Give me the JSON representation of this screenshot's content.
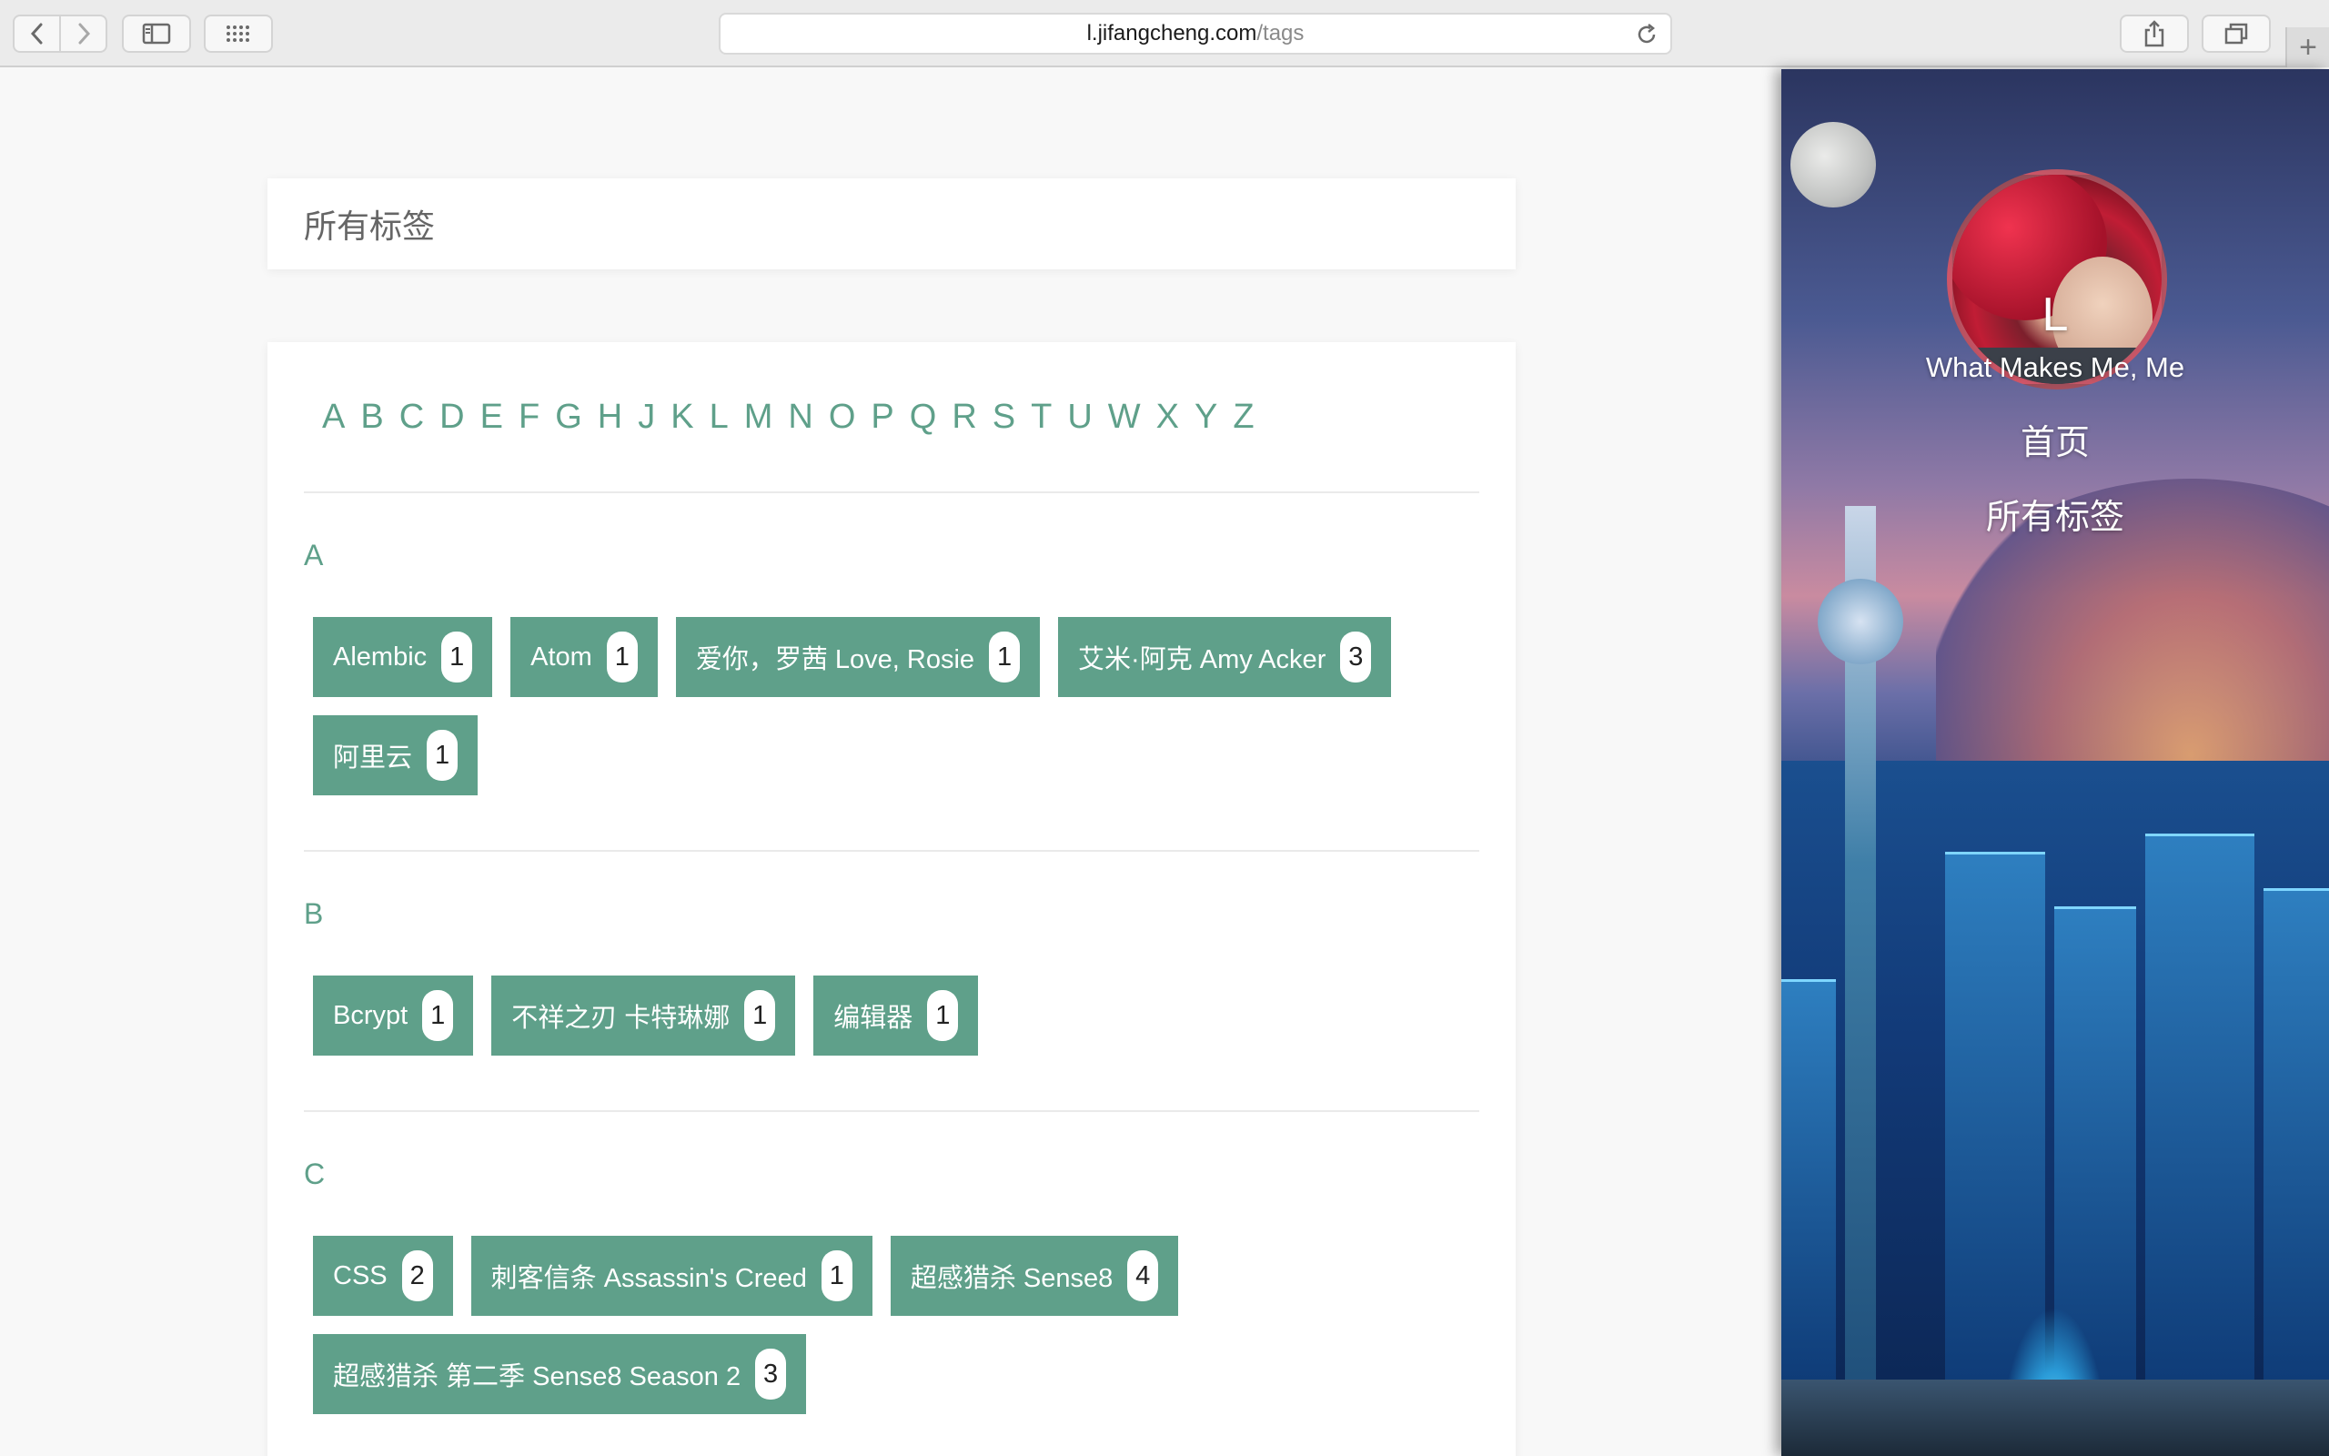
{
  "browser": {
    "url_host": "l.jifangcheng.com",
    "url_path": "/tags",
    "newtab_label": "+"
  },
  "page": {
    "title": "所有标签"
  },
  "alphabet": [
    "A",
    "B",
    "C",
    "D",
    "E",
    "F",
    "G",
    "H",
    "J",
    "K",
    "L",
    "M",
    "N",
    "O",
    "P",
    "Q",
    "R",
    "S",
    "T",
    "U",
    "W",
    "X",
    "Y",
    "Z"
  ],
  "sections": [
    {
      "letter": "A",
      "tags": [
        {
          "name": "Alembic",
          "count": "1"
        },
        {
          "name": "Atom",
          "count": "1"
        },
        {
          "name": "爱你，罗茜 Love, Rosie",
          "count": "1"
        },
        {
          "name": "艾米·阿克 Amy Acker",
          "count": "3"
        },
        {
          "name": "阿里云",
          "count": "1"
        }
      ]
    },
    {
      "letter": "B",
      "tags": [
        {
          "name": "Bcrypt",
          "count": "1"
        },
        {
          "name": "不祥之刃 卡特琳娜",
          "count": "1"
        },
        {
          "name": "编辑器",
          "count": "1"
        }
      ]
    },
    {
      "letter": "C",
      "tags": [
        {
          "name": "CSS",
          "count": "2"
        },
        {
          "name": "刺客信条 Assassin's Creed",
          "count": "1"
        },
        {
          "name": "超感猎杀 Sense8",
          "count": "4"
        },
        {
          "name": "超感猎杀 第二季 Sense8 Season 2",
          "count": "3"
        }
      ]
    }
  ],
  "sidebar": {
    "name": "L",
    "description": "What Makes Me, Me",
    "nav": [
      {
        "label": "首页"
      },
      {
        "label": "所有标签"
      }
    ]
  },
  "colors": {
    "accent": "#5fa08a",
    "card_bg": "#ffffff",
    "page_bg": "#f8f8f8"
  }
}
